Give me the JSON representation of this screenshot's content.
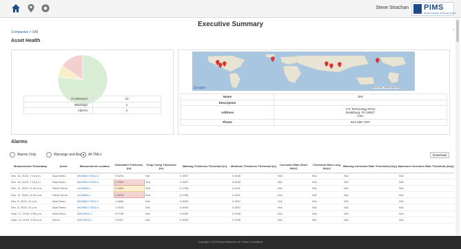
{
  "header": {
    "nav_icons": [
      "home-icon",
      "map-pin-icon",
      "gear-icon"
    ],
    "user_name": "Steve Strachan",
    "logo_text": "PIMS",
    "logo_subtext": "Pipeline integrity monitoring system"
  },
  "page": {
    "title": "Executive Summary",
    "breadcrumb_link": "Companies",
    "breadcrumb_rest": " > SNI"
  },
  "asset_health": {
    "title": "Asset Health",
    "chart_data": {
      "type": "pie",
      "categories": [
        "In tolerance",
        "Warnings",
        "Alarms"
      ],
      "values": [
        10,
        1,
        2
      ],
      "colors": [
        "#d9ecd4",
        "#f8efc9",
        "#f3d0d0"
      ]
    },
    "rows": [
      {
        "label": "In tolerance:",
        "value": "10"
      },
      {
        "label": "Warnings:",
        "value": "1"
      },
      {
        "label": "Alarms:",
        "value": "2"
      }
    ]
  },
  "company": {
    "rows": [
      {
        "label": "Name",
        "value": "SNI"
      },
      {
        "label": "Description",
        "value": ""
      },
      {
        "label": "Address",
        "value": "171 Technology Drive\nBoalsburg, PA 16827\nUSA"
      },
      {
        "label": "Phone",
        "value": "814-466-7207"
      }
    ],
    "map_google_label": "Google",
    "map_credits": "Terms of Use   Report a map error"
  },
  "alarms": {
    "title": "Alarms",
    "filters": [
      {
        "label": "Alarms Only",
        "selected": false
      },
      {
        "label": "Warnings and Alarms",
        "selected": false
      },
      {
        "label": "All TMLs",
        "selected": true
      }
    ],
    "download_label": "Download",
    "columns": [
      "Measurement Timestamp",
      "Asset",
      "Measurement Location",
      "Calculated Thickness (in)",
      "Temp Comp Thickness (in)",
      "Warning Thickness Threshold (in)",
      "Minimum Thickness Threshold (in)",
      "Corrosion Rate Short (in/yr)",
      "Corrosion Rate Long (in/yr)",
      "Warning Corrosion Rate Threshold (in/yr)",
      "Maximum Corrosion Rate Threshold (in/yr)"
    ],
    "rows": [
      [
        "Dec. 18, 2015, 7:15 p.m.",
        "Asia Demo",
        "#5190817-0012-2",
        "0.5294",
        "N/A",
        "0.3937",
        "0.3150",
        "N/A",
        "N/A",
        "N/A",
        "N/A"
      ],
      [
        "Dec. 18, 2015, 7:15 p.m.",
        "Asia Demo",
        "#5190817-0012-1",
        "0.2502",
        "N/A",
        "0.3937",
        "0.3150",
        "N/A",
        "N/A",
        "N/A",
        "N/A"
      ],
      [
        "Dec. 11, 2015, 11:34 a.m.",
        "Steve Demo",
        "#123456-2",
        "0.1551",
        "N/A",
        "0.2756",
        "0.1181",
        "N/A",
        "N/A",
        "N/A",
        "N/A"
      ],
      [
        "Dec. 11, 2015, 11:34 a.m.",
        "Steve Demo",
        "#123456-1",
        "0.0000",
        "N/A",
        "0.2756",
        "0.1181",
        "N/A",
        "N/A",
        "N/A",
        "N/A"
      ],
      [
        "Dec. 8, 2015, 10 p.m.",
        "Asia Demo",
        "#5190817-0012-1",
        "1.0666",
        "N/A",
        "0.0000",
        "0.3937",
        "N/A",
        "N/A",
        "N/A",
        "N/A"
      ],
      [
        "Dec. 8, 2015, 10 p.m.",
        "Asia Demo",
        "#5190817-0012-2",
        "1.1543",
        "N/A",
        "0.0000",
        "0.3937",
        "N/A",
        "N/A",
        "N/A",
        "N/A"
      ],
      [
        "Sept. 17, 2015, 2:50 p.m.",
        "Asia Demo",
        "#00i-0002-1",
        "0.2736",
        "N/A",
        "0.0000",
        "0.2165",
        "N/A",
        "N/A",
        "N/A",
        "N/A"
      ],
      [
        "Sept. 14, 2015, 9:03 a.m.",
        "Demo",
        "#00i-0002-1",
        "0.4907",
        "N/A",
        "0.0000",
        "0.2165",
        "N/A",
        "N/A",
        "N/A",
        "N/A"
      ]
    ],
    "highlights": {
      "1": "red",
      "2": "yellow",
      "3": "red"
    }
  },
  "footer": {
    "text": "Copyright © 2015 Sensor Networks, Inc. Terms & Conditions"
  }
}
